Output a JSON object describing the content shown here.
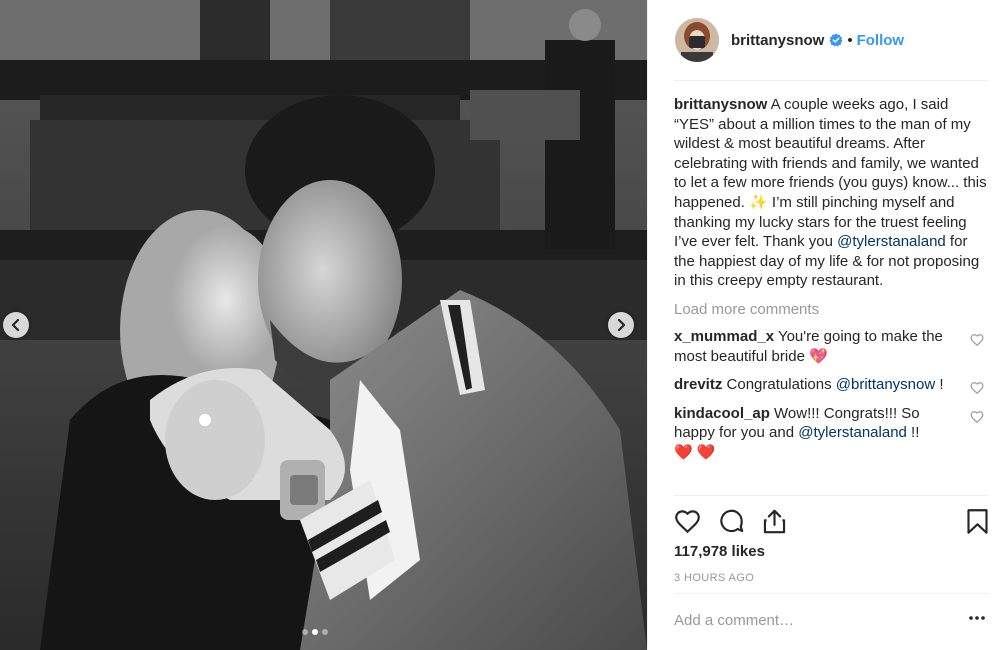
{
  "post": {
    "username": "brittanysnow",
    "follow_label": "Follow",
    "separator": "•",
    "caption_user": "brittanysnow",
    "caption_part1": " A couple weeks ago, I said “YES” about a million times to the man of my wildest & most beautiful dreams. After celebrating with friends and family, we wanted to let a few more friends (you guys) know... this happened. ",
    "caption_sparkle": "✨",
    "caption_part2": " I’m still pinching myself and thanking my lucky stars for the truest feeling I’ve ever felt. Thank you ",
    "caption_mention": "@tylerstanaland",
    "caption_part3": " for the happiest day of my life & for not proposing in this creepy empty restaurant.",
    "load_more": "Load more comments",
    "likes": "117,978 likes",
    "time": "3 HOURS AGO",
    "add_comment_placeholder": "Add a comment…",
    "more_label": "•••"
  },
  "comments": [
    {
      "user": "x_mummad_x",
      "text_before": " You're going to make the most beautiful bride ",
      "mention": "",
      "text_after": "",
      "emoji": "💖"
    },
    {
      "user": "drevitz",
      "text_before": " Congratulations ",
      "mention": "@brittanysnow",
      "text_after": " !",
      "emoji": ""
    },
    {
      "user": "kindacool_ap",
      "text_before": " Wow!!! Congrats!!! So happy for you and ",
      "mention": "@tylerstanaland",
      "text_after": " !!",
      "emoji": "❤️ ❤️"
    }
  ],
  "photo": {
    "carousel_count": 3,
    "active_index": 1
  },
  "colors": {
    "accent": "#3897f0",
    "mention": "#003569",
    "muted": "#999999",
    "text": "#262626",
    "divider": "#efefef"
  },
  "icons": {
    "prev": "chevron-left-icon",
    "next": "chevron-right-icon",
    "verified": "verified-badge-icon",
    "like": "heart-icon",
    "comment": "comment-icon",
    "share": "share-icon",
    "save": "bookmark-icon",
    "more": "more-options-icon"
  }
}
